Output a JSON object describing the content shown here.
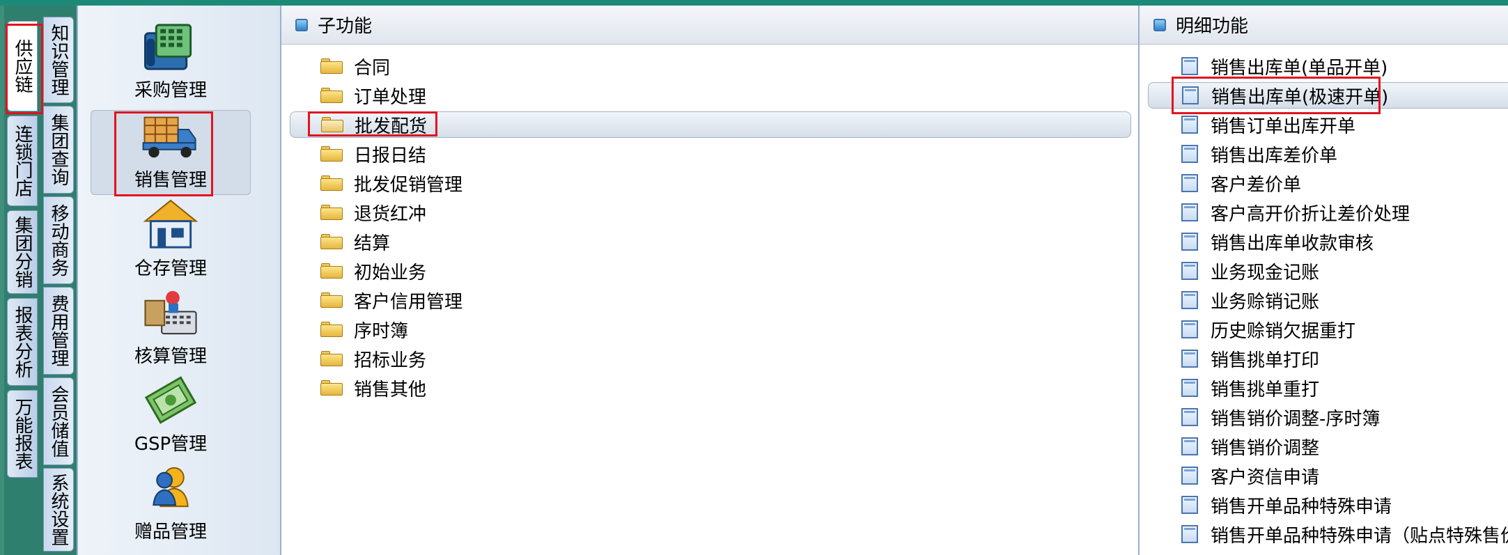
{
  "left_tabs": [
    {
      "label": "供应链",
      "active": true
    },
    {
      "label": "连锁门店",
      "active": false
    },
    {
      "label": "集团分销",
      "active": false
    },
    {
      "label": "报表分析",
      "active": false
    },
    {
      "label": "万能报表",
      "active": false
    }
  ],
  "right_tabs": [
    {
      "label": "知识管理"
    },
    {
      "label": "集团查询"
    },
    {
      "label": "移动商务"
    },
    {
      "label": "费用管理"
    },
    {
      "label": "会员储值"
    },
    {
      "label": "系统设置"
    }
  ],
  "categories": [
    {
      "label": "采购管理",
      "icon": "cash-register-icon",
      "selected": false
    },
    {
      "label": "销售管理",
      "icon": "delivery-truck-icon",
      "selected": true
    },
    {
      "label": "仓存管理",
      "icon": "warehouse-icon",
      "selected": false
    },
    {
      "label": "核算管理",
      "icon": "accounting-icon",
      "selected": false
    },
    {
      "label": "GSP管理",
      "icon": "money-icon",
      "selected": false
    },
    {
      "label": "赠品管理",
      "icon": "gift-user-icon",
      "selected": false
    }
  ],
  "subfunctions": {
    "title": "子功能",
    "items": [
      {
        "label": "合同"
      },
      {
        "label": "订单处理"
      },
      {
        "label": "批发配货",
        "selected": true
      },
      {
        "label": "日报日结"
      },
      {
        "label": "批发促销管理"
      },
      {
        "label": "退货红冲"
      },
      {
        "label": "结算"
      },
      {
        "label": "初始业务"
      },
      {
        "label": "客户信用管理"
      },
      {
        "label": "序时簿"
      },
      {
        "label": "招标业务"
      },
      {
        "label": "销售其他"
      }
    ]
  },
  "details": {
    "title": "明细功能",
    "items": [
      {
        "label": "销售出库单(单品开单)"
      },
      {
        "label": "销售出库单(极速开单)",
        "selected": true
      },
      {
        "label": "销售订单出库开单"
      },
      {
        "label": "销售出库差价单"
      },
      {
        "label": "客户差价单"
      },
      {
        "label": "客户高开价折让差价处理"
      },
      {
        "label": "销售出库单收款审核"
      },
      {
        "label": "业务现金记账"
      },
      {
        "label": "业务赊销记账"
      },
      {
        "label": "历史赊销欠据重打"
      },
      {
        "label": "销售挑单打印"
      },
      {
        "label": "销售挑单重打"
      },
      {
        "label": "销售销价调整-序时簿"
      },
      {
        "label": "销售销价调整"
      },
      {
        "label": "客户资信申请"
      },
      {
        "label": "销售开单品种特殊申请"
      },
      {
        "label": "销售开单品种特殊申请（贴点特殊售价）"
      }
    ]
  },
  "colors": {
    "highlight_box": "#e0141e",
    "background": "#3f8f7a"
  }
}
